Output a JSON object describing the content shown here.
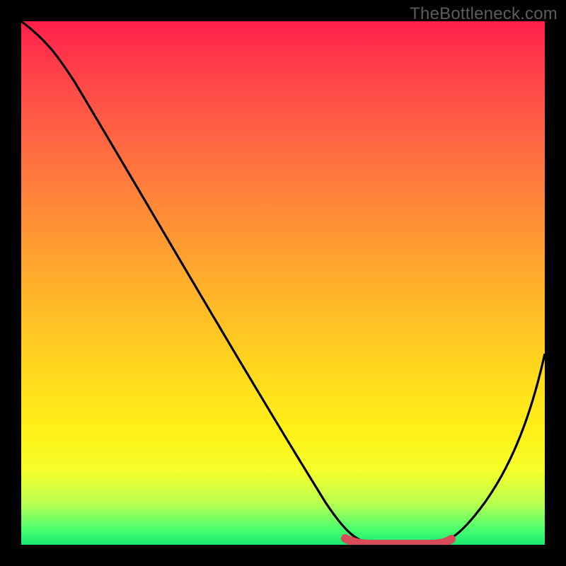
{
  "attribution": "TheBottleneck.com",
  "chart_data": {
    "type": "line",
    "title": "",
    "xlabel": "",
    "ylabel": "",
    "ylim": [
      0,
      100
    ],
    "x": [
      0.0,
      0.06,
      0.12,
      0.18,
      0.24,
      0.3,
      0.36,
      0.42,
      0.48,
      0.54,
      0.6,
      0.64,
      0.68,
      0.72,
      0.76,
      0.8,
      0.86,
      0.92,
      1.0
    ],
    "values": [
      100,
      93,
      85,
      76,
      66,
      56,
      46,
      36,
      26,
      16,
      6,
      2,
      0,
      0,
      0,
      1,
      5,
      14,
      37
    ],
    "marker_region": {
      "start_x": 0.62,
      "end_x": 0.8
    },
    "colors": {
      "gradient_top": "#ff1f4b",
      "gradient_bottom": "#17e86f",
      "line": "#000000",
      "marker": "#d74b5a",
      "frame": "#000000"
    }
  }
}
